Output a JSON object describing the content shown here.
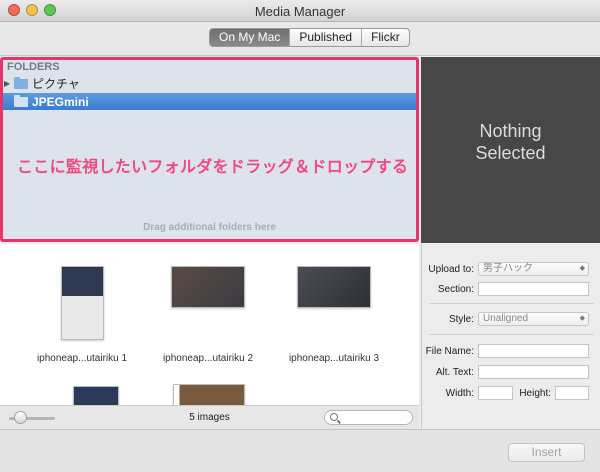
{
  "window": {
    "title": "Media Manager"
  },
  "tabs": [
    {
      "label": "On My Mac",
      "active": true
    },
    {
      "label": "Published",
      "active": false
    },
    {
      "label": "Flickr",
      "active": false
    }
  ],
  "folders": {
    "header": "FOLDERS",
    "items": [
      {
        "label": "ピクチャ",
        "selected": false
      },
      {
        "label": "JPEGmini",
        "selected": true
      }
    ],
    "annotation": "ここに監視したいフォルダをドラッグ＆ドロップする",
    "drag_hint": "Drag additional folders here",
    "highlight_color": "#e8336b"
  },
  "preview": {
    "line1": "Nothing",
    "line2": "Selected"
  },
  "settings": {
    "upload_to_label": "Upload to:",
    "upload_to_value": "男子ハック",
    "section_label": "Section:",
    "style_label": "Style:",
    "style_value": "Unaligned",
    "filename_label": "File Name:",
    "alt_text_label": "Alt. Text:",
    "width_label": "Width:",
    "height_label": "Height:"
  },
  "thumbnails": [
    {
      "caption": "iphoneap...utairiku 1"
    },
    {
      "caption": "iphoneap...utairiku 2"
    },
    {
      "caption": "iphoneap...utairiku 3"
    }
  ],
  "status": {
    "count": "5 images"
  },
  "footer": {
    "insert_label": "Insert"
  }
}
